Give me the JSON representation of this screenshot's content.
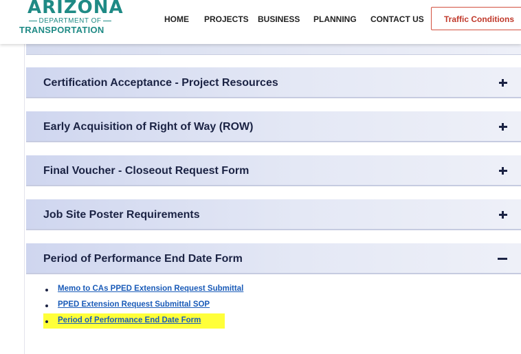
{
  "header": {
    "logo": {
      "name": "ARIZONA",
      "sub": "DEPARTMENT OF",
      "name2": "TRANSPORTATION"
    },
    "nav": [
      "HOME",
      "PROJECTS",
      "BUSINESS",
      "PLANNING",
      "CONTACT US"
    ],
    "traffic_button": "Traffic Conditions"
  },
  "accordion": {
    "items": [
      {
        "title": "Certification Acceptance - Project Resources",
        "state": "collapsed",
        "icon": "plus-icon"
      },
      {
        "title": "Early Acquisition of Right of Way (ROW)",
        "state": "collapsed",
        "icon": "plus-icon"
      },
      {
        "title": "Final Voucher - Closeout Request Form",
        "state": "collapsed",
        "icon": "plus-icon"
      },
      {
        "title": "Job Site Poster Requirements",
        "state": "collapsed",
        "icon": "plus-icon"
      },
      {
        "title": "Period of Performance End Date Form",
        "state": "expanded",
        "icon": "minus-icon"
      }
    ],
    "expanded_links": [
      "Memo to CAs PPED Extension Request Submittal",
      "PPED Extension Request Submittal SOP",
      "Period of Performance End Date Form"
    ]
  },
  "colors": {
    "brand": "#1f8a85",
    "accordion_text": "#1b2344",
    "link": "#1a5bb8",
    "traffic_border": "#d2503f",
    "highlight": "#ffff3a"
  }
}
